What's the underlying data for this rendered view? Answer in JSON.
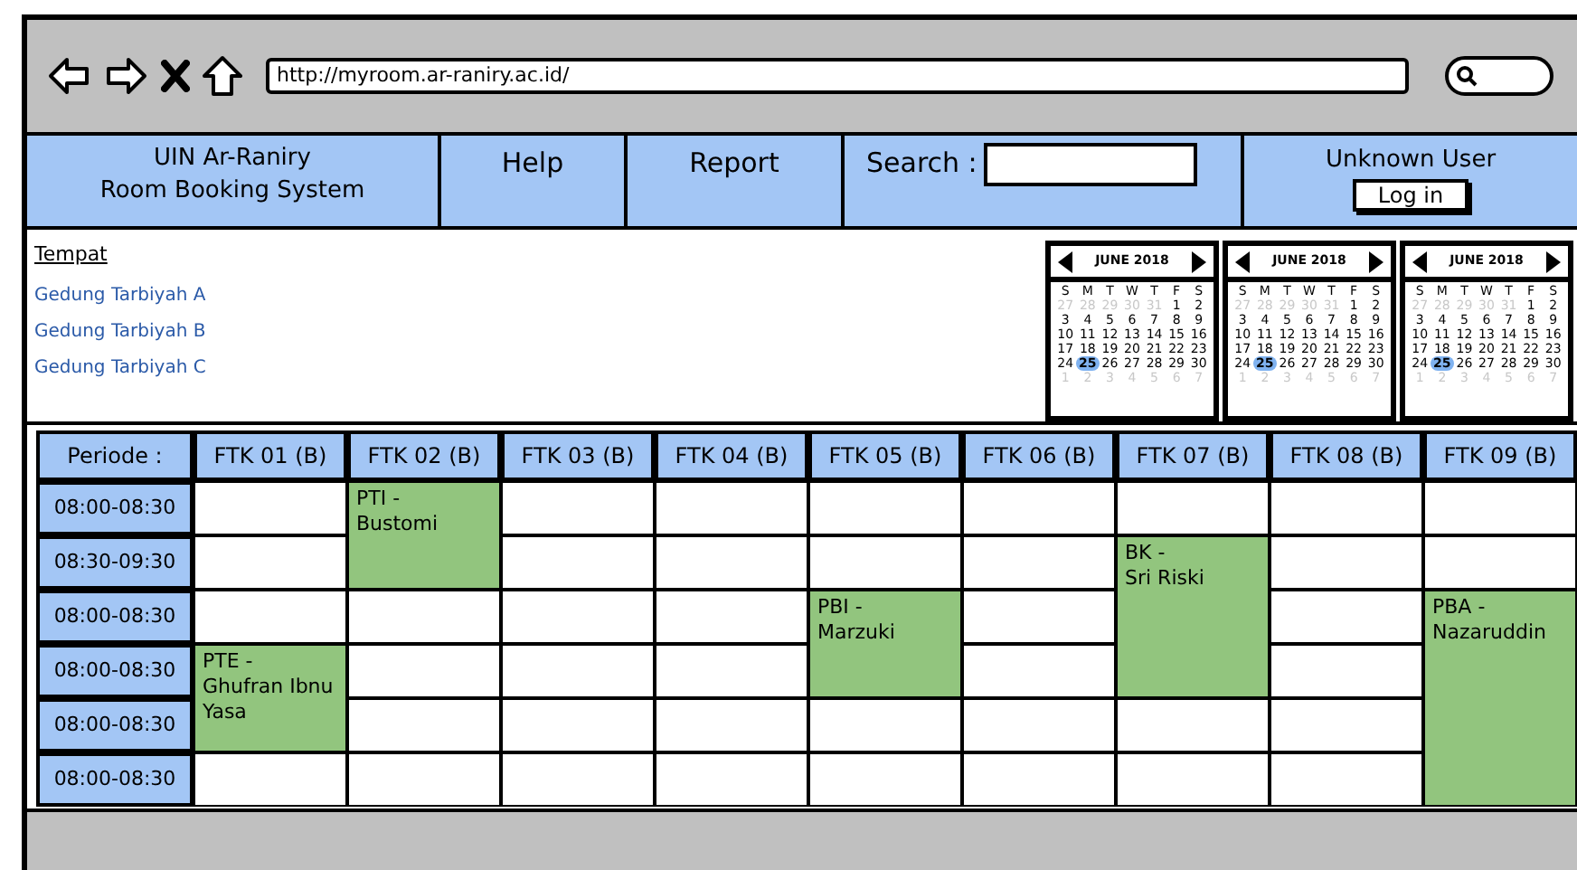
{
  "browser": {
    "url": "http://myroom.ar-raniry.ac.id/"
  },
  "nav": {
    "title_lines": [
      "UIN Ar-Raniry",
      "Room Booking System"
    ],
    "links": [
      "Help",
      "Report"
    ],
    "search_label": "Search :",
    "user": "Unknown User",
    "login": "Log in"
  },
  "places": {
    "heading": "Tempat",
    "items": [
      "Gedung Tarbiyah A",
      "Gedung Tarbiyah B",
      "Gedung Tarbiyah C"
    ]
  },
  "calendars": [
    {
      "title": "JUNE 2018",
      "weekdays": [
        "S",
        "M",
        "T",
        "W",
        "T",
        "F",
        "S"
      ],
      "weeks": [
        {
          "days": [
            {
              "label": "27",
              "kind": "other",
              "selected": false
            },
            {
              "label": "28",
              "kind": "other",
              "selected": false
            },
            {
              "label": "29",
              "kind": "other",
              "selected": false
            },
            {
              "label": "30",
              "kind": "other",
              "selected": false
            },
            {
              "label": "31",
              "kind": "other",
              "selected": false
            },
            {
              "label": "1",
              "kind": "current",
              "selected": false
            },
            {
              "label": "2",
              "kind": "current",
              "selected": false
            }
          ]
        },
        {
          "days": [
            {
              "label": "3",
              "kind": "current",
              "selected": false
            },
            {
              "label": "4",
              "kind": "current",
              "selected": false
            },
            {
              "label": "5",
              "kind": "current",
              "selected": false
            },
            {
              "label": "6",
              "kind": "current",
              "selected": false
            },
            {
              "label": "7",
              "kind": "current",
              "selected": false
            },
            {
              "label": "8",
              "kind": "current",
              "selected": false
            },
            {
              "label": "9",
              "kind": "current",
              "selected": false
            }
          ]
        },
        {
          "days": [
            {
              "label": "10",
              "kind": "current",
              "selected": false
            },
            {
              "label": "11",
              "kind": "current",
              "selected": false
            },
            {
              "label": "12",
              "kind": "current",
              "selected": false
            },
            {
              "label": "13",
              "kind": "current",
              "selected": false
            },
            {
              "label": "14",
              "kind": "current",
              "selected": false
            },
            {
              "label": "15",
              "kind": "current",
              "selected": false
            },
            {
              "label": "16",
              "kind": "current",
              "selected": false
            }
          ]
        },
        {
          "days": [
            {
              "label": "17",
              "kind": "current",
              "selected": false
            },
            {
              "label": "18",
              "kind": "current",
              "selected": false
            },
            {
              "label": "19",
              "kind": "current",
              "selected": false
            },
            {
              "label": "20",
              "kind": "current",
              "selected": false
            },
            {
              "label": "21",
              "kind": "current",
              "selected": false
            },
            {
              "label": "22",
              "kind": "current",
              "selected": false
            },
            {
              "label": "23",
              "kind": "current",
              "selected": false
            }
          ]
        },
        {
          "days": [
            {
              "label": "24",
              "kind": "current",
              "selected": false
            },
            {
              "label": "25",
              "kind": "current",
              "selected": true
            },
            {
              "label": "26",
              "kind": "current",
              "selected": false
            },
            {
              "label": "27",
              "kind": "current",
              "selected": false
            },
            {
              "label": "28",
              "kind": "current",
              "selected": false
            },
            {
              "label": "29",
              "kind": "current",
              "selected": false
            },
            {
              "label": "30",
              "kind": "current",
              "selected": false
            }
          ]
        },
        {
          "days": [
            {
              "label": "1",
              "kind": "other",
              "selected": false
            },
            {
              "label": "2",
              "kind": "other",
              "selected": false
            },
            {
              "label": "3",
              "kind": "other",
              "selected": false
            },
            {
              "label": "4",
              "kind": "other",
              "selected": false
            },
            {
              "label": "5",
              "kind": "other",
              "selected": false
            },
            {
              "label": "6",
              "kind": "other",
              "selected": false
            },
            {
              "label": "7",
              "kind": "other",
              "selected": false
            }
          ]
        }
      ]
    },
    {
      "title": "JUNE 2018",
      "weekdays": [
        "S",
        "M",
        "T",
        "W",
        "T",
        "F",
        "S"
      ],
      "weeks": [
        {
          "days": [
            {
              "label": "27",
              "kind": "other",
              "selected": false
            },
            {
              "label": "28",
              "kind": "other",
              "selected": false
            },
            {
              "label": "29",
              "kind": "other",
              "selected": false
            },
            {
              "label": "30",
              "kind": "other",
              "selected": false
            },
            {
              "label": "31",
              "kind": "other",
              "selected": false
            },
            {
              "label": "1",
              "kind": "current",
              "selected": false
            },
            {
              "label": "2",
              "kind": "current",
              "selected": false
            }
          ]
        },
        {
          "days": [
            {
              "label": "3",
              "kind": "current",
              "selected": false
            },
            {
              "label": "4",
              "kind": "current",
              "selected": false
            },
            {
              "label": "5",
              "kind": "current",
              "selected": false
            },
            {
              "label": "6",
              "kind": "current",
              "selected": false
            },
            {
              "label": "7",
              "kind": "current",
              "selected": false
            },
            {
              "label": "8",
              "kind": "current",
              "selected": false
            },
            {
              "label": "9",
              "kind": "current",
              "selected": false
            }
          ]
        },
        {
          "days": [
            {
              "label": "10",
              "kind": "current",
              "selected": false
            },
            {
              "label": "11",
              "kind": "current",
              "selected": false
            },
            {
              "label": "12",
              "kind": "current",
              "selected": false
            },
            {
              "label": "13",
              "kind": "current",
              "selected": false
            },
            {
              "label": "14",
              "kind": "current",
              "selected": false
            },
            {
              "label": "15",
              "kind": "current",
              "selected": false
            },
            {
              "label": "16",
              "kind": "current",
              "selected": false
            }
          ]
        },
        {
          "days": [
            {
              "label": "17",
              "kind": "current",
              "selected": false
            },
            {
              "label": "18",
              "kind": "current",
              "selected": false
            },
            {
              "label": "19",
              "kind": "current",
              "selected": false
            },
            {
              "label": "20",
              "kind": "current",
              "selected": false
            },
            {
              "label": "21",
              "kind": "current",
              "selected": false
            },
            {
              "label": "22",
              "kind": "current",
              "selected": false
            },
            {
              "label": "23",
              "kind": "current",
              "selected": false
            }
          ]
        },
        {
          "days": [
            {
              "label": "24",
              "kind": "current",
              "selected": false
            },
            {
              "label": "25",
              "kind": "current",
              "selected": true
            },
            {
              "label": "26",
              "kind": "current",
              "selected": false
            },
            {
              "label": "27",
              "kind": "current",
              "selected": false
            },
            {
              "label": "28",
              "kind": "current",
              "selected": false
            },
            {
              "label": "29",
              "kind": "current",
              "selected": false
            },
            {
              "label": "30",
              "kind": "current",
              "selected": false
            }
          ]
        },
        {
          "days": [
            {
              "label": "1",
              "kind": "other",
              "selected": false
            },
            {
              "label": "2",
              "kind": "other",
              "selected": false
            },
            {
              "label": "3",
              "kind": "other",
              "selected": false
            },
            {
              "label": "4",
              "kind": "other",
              "selected": false
            },
            {
              "label": "5",
              "kind": "other",
              "selected": false
            },
            {
              "label": "6",
              "kind": "other",
              "selected": false
            },
            {
              "label": "7",
              "kind": "other",
              "selected": false
            }
          ]
        }
      ]
    },
    {
      "title": "JUNE 2018",
      "weekdays": [
        "S",
        "M",
        "T",
        "W",
        "T",
        "F",
        "S"
      ],
      "weeks": [
        {
          "days": [
            {
              "label": "27",
              "kind": "other",
              "selected": false
            },
            {
              "label": "28",
              "kind": "other",
              "selected": false
            },
            {
              "label": "29",
              "kind": "other",
              "selected": false
            },
            {
              "label": "30",
              "kind": "other",
              "selected": false
            },
            {
              "label": "31",
              "kind": "other",
              "selected": false
            },
            {
              "label": "1",
              "kind": "current",
              "selected": false
            },
            {
              "label": "2",
              "kind": "current",
              "selected": false
            }
          ]
        },
        {
          "days": [
            {
              "label": "3",
              "kind": "current",
              "selected": false
            },
            {
              "label": "4",
              "kind": "current",
              "selected": false
            },
            {
              "label": "5",
              "kind": "current",
              "selected": false
            },
            {
              "label": "6",
              "kind": "current",
              "selected": false
            },
            {
              "label": "7",
              "kind": "current",
              "selected": false
            },
            {
              "label": "8",
              "kind": "current",
              "selected": false
            },
            {
              "label": "9",
              "kind": "current",
              "selected": false
            }
          ]
        },
        {
          "days": [
            {
              "label": "10",
              "kind": "current",
              "selected": false
            },
            {
              "label": "11",
              "kind": "current",
              "selected": false
            },
            {
              "label": "12",
              "kind": "current",
              "selected": false
            },
            {
              "label": "13",
              "kind": "current",
              "selected": false
            },
            {
              "label": "14",
              "kind": "current",
              "selected": false
            },
            {
              "label": "15",
              "kind": "current",
              "selected": false
            },
            {
              "label": "16",
              "kind": "current",
              "selected": false
            }
          ]
        },
        {
          "days": [
            {
              "label": "17",
              "kind": "current",
              "selected": false
            },
            {
              "label": "18",
              "kind": "current",
              "selected": false
            },
            {
              "label": "19",
              "kind": "current",
              "selected": false
            },
            {
              "label": "20",
              "kind": "current",
              "selected": false
            },
            {
              "label": "21",
              "kind": "current",
              "selected": false
            },
            {
              "label": "22",
              "kind": "current",
              "selected": false
            },
            {
              "label": "23",
              "kind": "current",
              "selected": false
            }
          ]
        },
        {
          "days": [
            {
              "label": "24",
              "kind": "current",
              "selected": false
            },
            {
              "label": "25",
              "kind": "current",
              "selected": true
            },
            {
              "label": "26",
              "kind": "current",
              "selected": false
            },
            {
              "label": "27",
              "kind": "current",
              "selected": false
            },
            {
              "label": "28",
              "kind": "current",
              "selected": false
            },
            {
              "label": "29",
              "kind": "current",
              "selected": false
            },
            {
              "label": "30",
              "kind": "current",
              "selected": false
            }
          ]
        },
        {
          "days": [
            {
              "label": "1",
              "kind": "other",
              "selected": false
            },
            {
              "label": "2",
              "kind": "other",
              "selected": false
            },
            {
              "label": "3",
              "kind": "other",
              "selected": false
            },
            {
              "label": "4",
              "kind": "other",
              "selected": false
            },
            {
              "label": "5",
              "kind": "other",
              "selected": false
            },
            {
              "label": "6",
              "kind": "other",
              "selected": false
            },
            {
              "label": "7",
              "kind": "other",
              "selected": false
            }
          ]
        }
      ]
    }
  ],
  "schedule": {
    "corner": "Periode :",
    "times": [
      "08:00-08:30",
      "08:30-09:30",
      "08:00-08:30",
      "08:00-08:30",
      "08:00-08:30",
      "08:00-08:30"
    ],
    "rooms": [
      {
        "label": "FTK 01 (B)",
        "slots": [
          {
            "kind": "empty"
          },
          {
            "kind": "empty"
          },
          {
            "kind": "empty"
          },
          {
            "kind": "booking",
            "code": "PTE -",
            "name": "Ghufran Ibnu Yasa"
          },
          {
            "kind": "continued"
          },
          {
            "kind": "empty"
          }
        ]
      },
      {
        "label": "FTK 02 (B)",
        "slots": [
          {
            "kind": "booking",
            "code": "PTI -",
            "name": "Bustomi"
          },
          {
            "kind": "continued"
          },
          {
            "kind": "empty"
          },
          {
            "kind": "empty"
          },
          {
            "kind": "empty"
          },
          {
            "kind": "empty"
          }
        ]
      },
      {
        "label": "FTK 03 (B)",
        "slots": [
          {
            "kind": "empty"
          },
          {
            "kind": "empty"
          },
          {
            "kind": "empty"
          },
          {
            "kind": "empty"
          },
          {
            "kind": "empty"
          },
          {
            "kind": "empty"
          }
        ]
      },
      {
        "label": "FTK 04 (B)",
        "slots": [
          {
            "kind": "empty"
          },
          {
            "kind": "empty"
          },
          {
            "kind": "empty"
          },
          {
            "kind": "empty"
          },
          {
            "kind": "empty"
          },
          {
            "kind": "empty"
          }
        ]
      },
      {
        "label": "FTK 05 (B)",
        "slots": [
          {
            "kind": "empty"
          },
          {
            "kind": "empty"
          },
          {
            "kind": "booking",
            "code": "PBI -",
            "name": "Marzuki"
          },
          {
            "kind": "continued"
          },
          {
            "kind": "empty"
          },
          {
            "kind": "empty"
          }
        ]
      },
      {
        "label": "FTK 06 (B)",
        "slots": [
          {
            "kind": "empty"
          },
          {
            "kind": "empty"
          },
          {
            "kind": "empty"
          },
          {
            "kind": "empty"
          },
          {
            "kind": "empty"
          },
          {
            "kind": "empty"
          }
        ]
      },
      {
        "label": "FTK 07 (B)",
        "slots": [
          {
            "kind": "empty"
          },
          {
            "kind": "booking",
            "code": "BK -",
            "name": "Sri Riski"
          },
          {
            "kind": "continued"
          },
          {
            "kind": "continued"
          },
          {
            "kind": "empty"
          },
          {
            "kind": "empty"
          }
        ]
      },
      {
        "label": "FTK 08 (B)",
        "slots": [
          {
            "kind": "empty"
          },
          {
            "kind": "empty"
          },
          {
            "kind": "empty"
          },
          {
            "kind": "empty"
          },
          {
            "kind": "empty"
          },
          {
            "kind": "empty"
          }
        ]
      },
      {
        "label": "FTK 09 (B)",
        "slots": [
          {
            "kind": "empty"
          },
          {
            "kind": "empty"
          },
          {
            "kind": "booking",
            "code": "PBA -",
            "name": "Nazaruddin"
          },
          {
            "kind": "continued"
          },
          {
            "kind": "continued"
          },
          {
            "kind": "continued"
          }
        ]
      }
    ]
  }
}
